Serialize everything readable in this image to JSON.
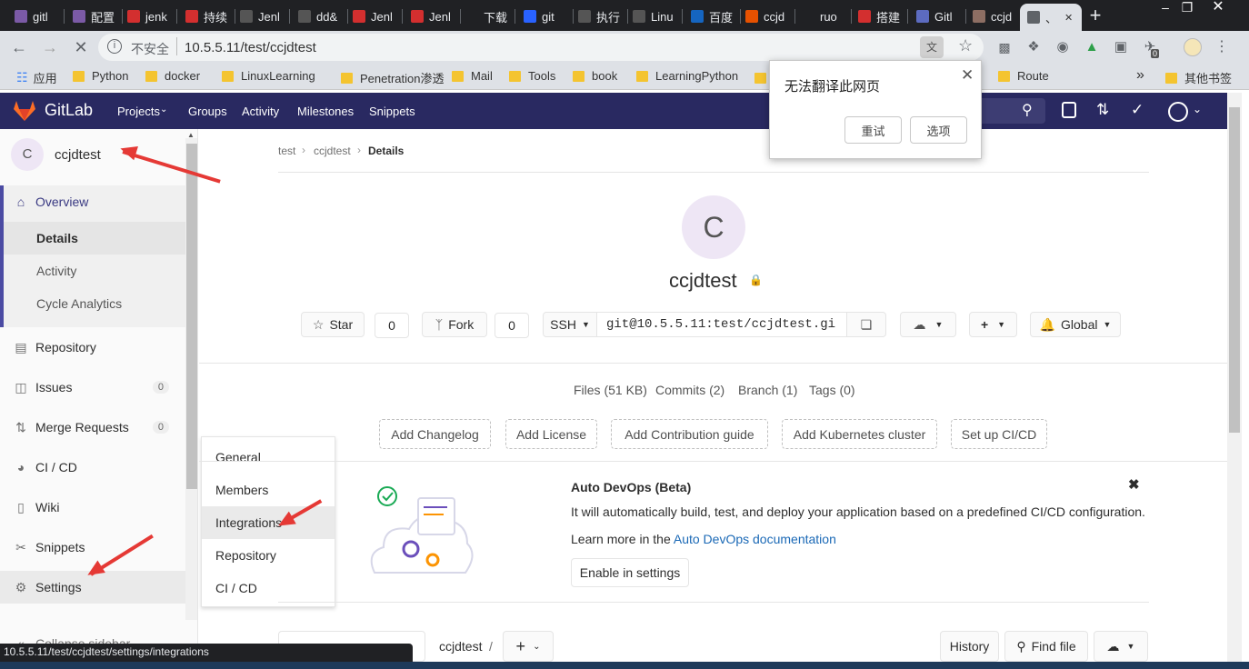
{
  "browser": {
    "tabs": [
      {
        "label": "gitl",
        "icon_color": "#7b5aa6",
        "icon": "gitlab-icon"
      },
      {
        "label": "配置",
        "icon_color": "#7b5aa6",
        "icon": "gitlab-icon"
      },
      {
        "label": "jenk",
        "icon_color": "#d32f2f",
        "icon": "csdn-icon"
      },
      {
        "label": "持续",
        "icon_color": "#d32f2f",
        "icon": "csdn-icon"
      },
      {
        "label": "Jenl",
        "icon_color": "#555555",
        "icon": "loading-icon"
      },
      {
        "label": "dd&",
        "icon_color": "#555555",
        "icon": "loading-icon"
      },
      {
        "label": "Jenl",
        "icon_color": "#d32f2f",
        "icon": "csdn-icon"
      },
      {
        "label": "Jenl",
        "icon_color": "#d32f2f",
        "icon": "csdn-icon"
      },
      {
        "label": "下载",
        "icon_color": "#202124",
        "icon": "download-icon"
      },
      {
        "label": "git",
        "icon_color": "#2962ff",
        "icon": "baidu-icon"
      },
      {
        "label": "执行",
        "icon_color": "#555555",
        "icon": "loading-icon"
      },
      {
        "label": "Linu",
        "icon_color": "#555555",
        "icon": "loading-icon"
      },
      {
        "label": "百度",
        "icon_color": "#1565c0",
        "icon": "translate-icon"
      },
      {
        "label": "ccjd",
        "icon_color": "#e65100",
        "icon": "close-x-icon"
      },
      {
        "label": "ruo",
        "icon_color": "#202124",
        "icon": "n-icon"
      },
      {
        "label": "搭建",
        "icon_color": "#d32f2f",
        "icon": "csdn-icon"
      },
      {
        "label": "Gitl",
        "icon_color": "#5c6bc0",
        "icon": "edit-icon"
      },
      {
        "label": "ccjd",
        "icon_color": "#8d6e63",
        "icon": "avatar-icon"
      },
      {
        "label": "、",
        "icon_color": "#5f6368",
        "icon": "loading-icon"
      }
    ],
    "omnibox": {
      "security": "不安全",
      "url": "10.5.5.11/test/ccjdtest"
    },
    "bookmarks": [
      {
        "label": "应用",
        "icon": "apps-icon"
      },
      {
        "label": "Python",
        "icon": "folder-icon"
      },
      {
        "label": "docker",
        "icon": "folder-icon"
      },
      {
        "label": "LinuxLearning",
        "icon": "folder-icon"
      },
      {
        "label": "Penetration渗透",
        "icon": "folder-icon"
      },
      {
        "label": "Mail",
        "icon": "folder-icon"
      },
      {
        "label": "Tools",
        "icon": "folder-icon"
      },
      {
        "label": "book",
        "icon": "folder-icon"
      },
      {
        "label": "LearningPython",
        "icon": "folder-icon"
      },
      {
        "label": "Route",
        "icon": "folder-icon"
      },
      {
        "label": "其他书签",
        "icon": "folder-icon"
      }
    ],
    "status_url": "10.5.5.11/test/ccjdtest/settings/integrations",
    "extension_badge": "0"
  },
  "translate_popup": {
    "message": "无法翻译此网页",
    "retry": "重试",
    "options": "选项"
  },
  "gitlab": {
    "brand": "GitLab",
    "header_color": "#292961",
    "nav": [
      "Projects",
      "Groups",
      "Activity",
      "Milestones",
      "Snippets"
    ],
    "project_avatar_letter": "C",
    "project_name": "ccjdtest",
    "sidebar": {
      "overview": "Overview",
      "overview_sub": [
        "Details",
        "Activity",
        "Cycle Analytics"
      ],
      "items": [
        {
          "label": "Repository",
          "icon": "book-icon"
        },
        {
          "label": "Issues",
          "icon": "issues-icon",
          "count": "0"
        },
        {
          "label": "Merge Requests",
          "icon": "merge-request-icon",
          "count": "0"
        },
        {
          "label": "CI / CD",
          "icon": "rocket-icon"
        },
        {
          "label": "Wiki",
          "icon": "wiki-icon"
        },
        {
          "label": "Snippets",
          "icon": "scissors-icon"
        },
        {
          "label": "Settings",
          "icon": "gear-icon"
        }
      ],
      "collapse": "Collapse sidebar"
    },
    "settings_flyout": [
      "General",
      "Members",
      "Integrations",
      "Repository",
      "CI / CD"
    ],
    "breadcrumb": [
      "test",
      "ccjdtest",
      "Details"
    ],
    "star": {
      "label": "Star",
      "count": "0"
    },
    "fork": {
      "label": "Fork",
      "count": "0"
    },
    "clone": {
      "protocol": "SSH",
      "url": "git@10.5.5.11:test/ccjdtest.gi"
    },
    "notification": "Global",
    "stats": [
      "Files (51 KB)",
      "Commits (2)",
      "Branch (1)",
      "Tags (0)"
    ],
    "quick_actions": [
      "Add Changelog",
      "Add License",
      "Add Contribution guide",
      "Add Kubernetes cluster",
      "Set up CI/CD"
    ],
    "autodevops": {
      "title": "Auto DevOps (Beta)",
      "description": "It will automatically build, test, and deploy your application based on a predefined CI/CD configuration.",
      "learn_prefix": "Learn more in the ",
      "learn_link": "Auto DevOps documentation",
      "button": "Enable in settings"
    },
    "file_bar": {
      "path": "ccjdtest",
      "separator": "/",
      "history": "History",
      "find_file": "Find file"
    }
  }
}
